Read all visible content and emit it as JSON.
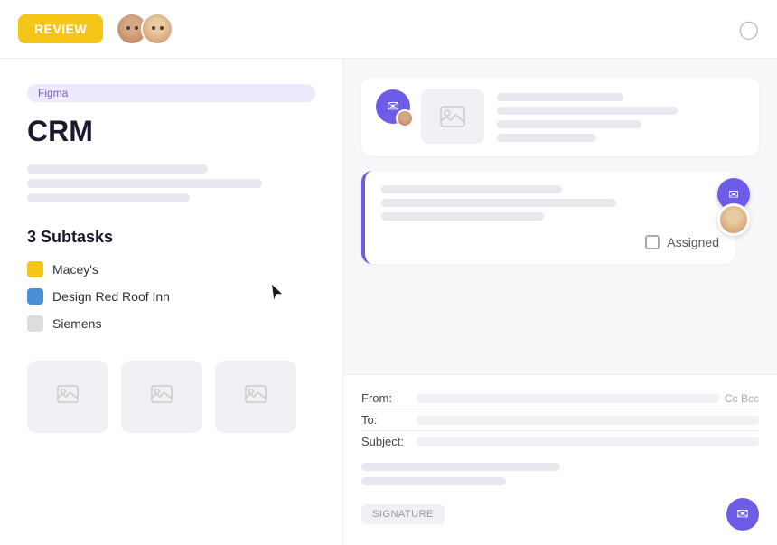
{
  "topbar": {
    "review_label": "REVIEW",
    "eye_icon": "👁"
  },
  "left": {
    "tag": "Figma",
    "title": "CRM",
    "desc_lines": [
      "long",
      "medium",
      "short"
    ],
    "subtasks_heading": "3 Subtasks",
    "subtasks": [
      {
        "name": "Macey's",
        "color": "yellow"
      },
      {
        "name": "Design Red Roof Inn",
        "color": "blue"
      },
      {
        "name": "Siemens",
        "color": "gray"
      }
    ],
    "thumbnails": [
      "image-icon",
      "image-icon",
      "image-icon"
    ]
  },
  "right": {
    "messages": [
      {
        "type": "card1",
        "lines": [
          "w1",
          "w2",
          "w3",
          "w4"
        ]
      },
      {
        "type": "card2",
        "lines": [
          "w1",
          "w2",
          "w3"
        ],
        "assigned_label": "Assigned"
      }
    ],
    "email": {
      "from_label": "From:",
      "to_label": "To:",
      "subject_label": "Subject:",
      "cc_bcc": "Cc Bcc",
      "body_lines": [
        "long",
        "medium"
      ],
      "signature_label": "SIGNATURE",
      "send_icon": "✉"
    }
  }
}
